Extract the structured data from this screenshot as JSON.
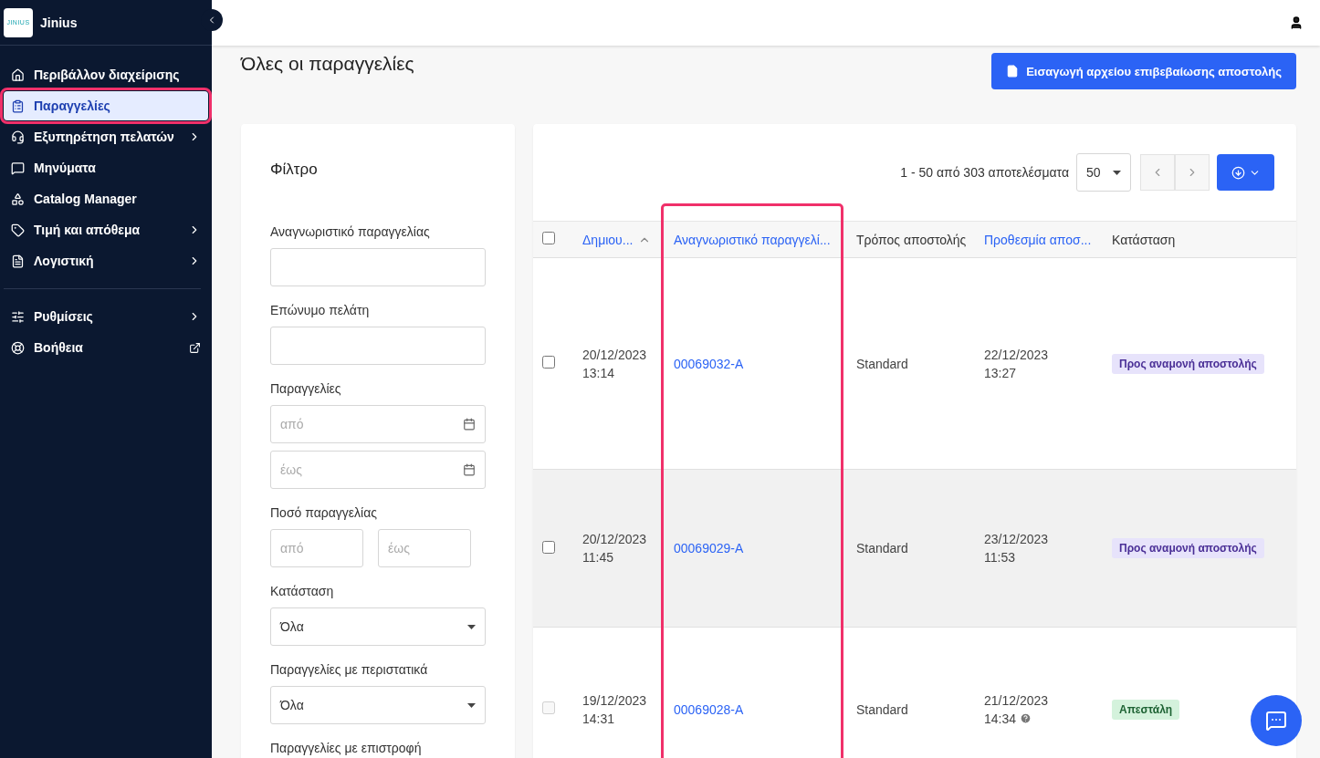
{
  "sidebar": {
    "brand": {
      "logo": "JINIUS",
      "name": "Jinius"
    },
    "items": [
      {
        "label": "Περιβάλλον διαχείρισης",
        "kind": "plain",
        "selected": false,
        "highlighted": false
      },
      {
        "label": "Παραγγελίες",
        "kind": "plain",
        "selected": true,
        "highlighted": true
      },
      {
        "label": "Εξυπηρέτηση πελατών",
        "kind": "submenu",
        "selected": false,
        "highlighted": false
      },
      {
        "label": "Μηνύματα",
        "kind": "plain",
        "selected": false,
        "highlighted": false
      },
      {
        "label": "Catalog Manager",
        "kind": "plain",
        "selected": false,
        "highlighted": false
      },
      {
        "label": "Τιμή και απόθεμα",
        "kind": "submenu",
        "selected": false,
        "highlighted": false
      },
      {
        "label": "Λογιστική",
        "kind": "submenu",
        "selected": false,
        "highlighted": false
      }
    ],
    "bottom_items": [
      {
        "label": "Ρυθμίσεις",
        "kind": "submenu",
        "selected": false,
        "highlighted": false
      },
      {
        "label": "Βοήθεια",
        "kind": "external",
        "selected": false,
        "highlighted": false
      }
    ]
  },
  "page": {
    "title": "Όλες οι παραγγελίες",
    "import_button": "Εισαγωγή αρχείου επιβεβαίωσης αποστολής"
  },
  "filter": {
    "title": "Φίλτρο",
    "fields": [
      {
        "kind": "text",
        "label": "Αναγνωριστικό παραγγελίας"
      },
      {
        "kind": "text",
        "label": "Επώνυμο πελάτη"
      },
      {
        "kind": "daterange",
        "label": "Παραγγελίες",
        "from_placeholder": "από",
        "to_placeholder": "έως"
      },
      {
        "kind": "range",
        "label": "Ποσό παραγγελίας",
        "from_placeholder": "από",
        "to_placeholder": "έως"
      },
      {
        "kind": "select",
        "label": "Κατάσταση",
        "value": "Όλα"
      },
      {
        "kind": "select",
        "label": "Παραγγελίες με περιστατικά",
        "value": "Όλα"
      },
      {
        "kind": "heading",
        "label": "Παραγγελίες με επιστροφή"
      }
    ]
  },
  "results": {
    "summary": "1 - 50 από 303 αποτελέσματα",
    "page_size": "50"
  },
  "table": {
    "select_all_checked": false,
    "columns": [
      {
        "label": "Δημιου...",
        "sortable": true,
        "sorted": true,
        "highlighted": false
      },
      {
        "label": "Αναγνωριστικό παραγγελί...",
        "sortable": true,
        "sorted": false,
        "highlighted": true
      },
      {
        "label": "Τρόπος αποστολής",
        "sortable": false,
        "sorted": false,
        "highlighted": false
      },
      {
        "label": "Προθεσμία αποσ...",
        "sortable": true,
        "sorted": false,
        "highlighted": false
      },
      {
        "label": "Κατάσταση",
        "sortable": false,
        "sorted": false,
        "highlighted": false
      }
    ],
    "rows": [
      {
        "checked": false,
        "disabled": false,
        "hovered": false,
        "created": [
          "20/12/2023",
          "13:14"
        ],
        "order_id": "00069032-A",
        "shipping": "Standard",
        "deadline": [
          "22/12/2023",
          "13:27"
        ],
        "deadline_info": false,
        "status": {
          "kind": "pending",
          "label": "Προς αναμονή αποστολής"
        }
      },
      {
        "checked": false,
        "disabled": false,
        "hovered": true,
        "created": [
          "20/12/2023",
          "11:45"
        ],
        "order_id": "00069029-A",
        "shipping": "Standard",
        "deadline": [
          "23/12/2023",
          "11:53"
        ],
        "deadline_info": false,
        "status": {
          "kind": "pending",
          "label": "Προς αναμονή αποστολής"
        }
      },
      {
        "checked": false,
        "disabled": true,
        "hovered": false,
        "created": [
          "19/12/2023",
          "14:31"
        ],
        "order_id": "00069028-A",
        "shipping": "Standard",
        "deadline": [
          "21/12/2023",
          "14:34"
        ],
        "deadline_info": true,
        "status": {
          "kind": "shipped",
          "label": "Απεστάλη"
        }
      }
    ]
  }
}
